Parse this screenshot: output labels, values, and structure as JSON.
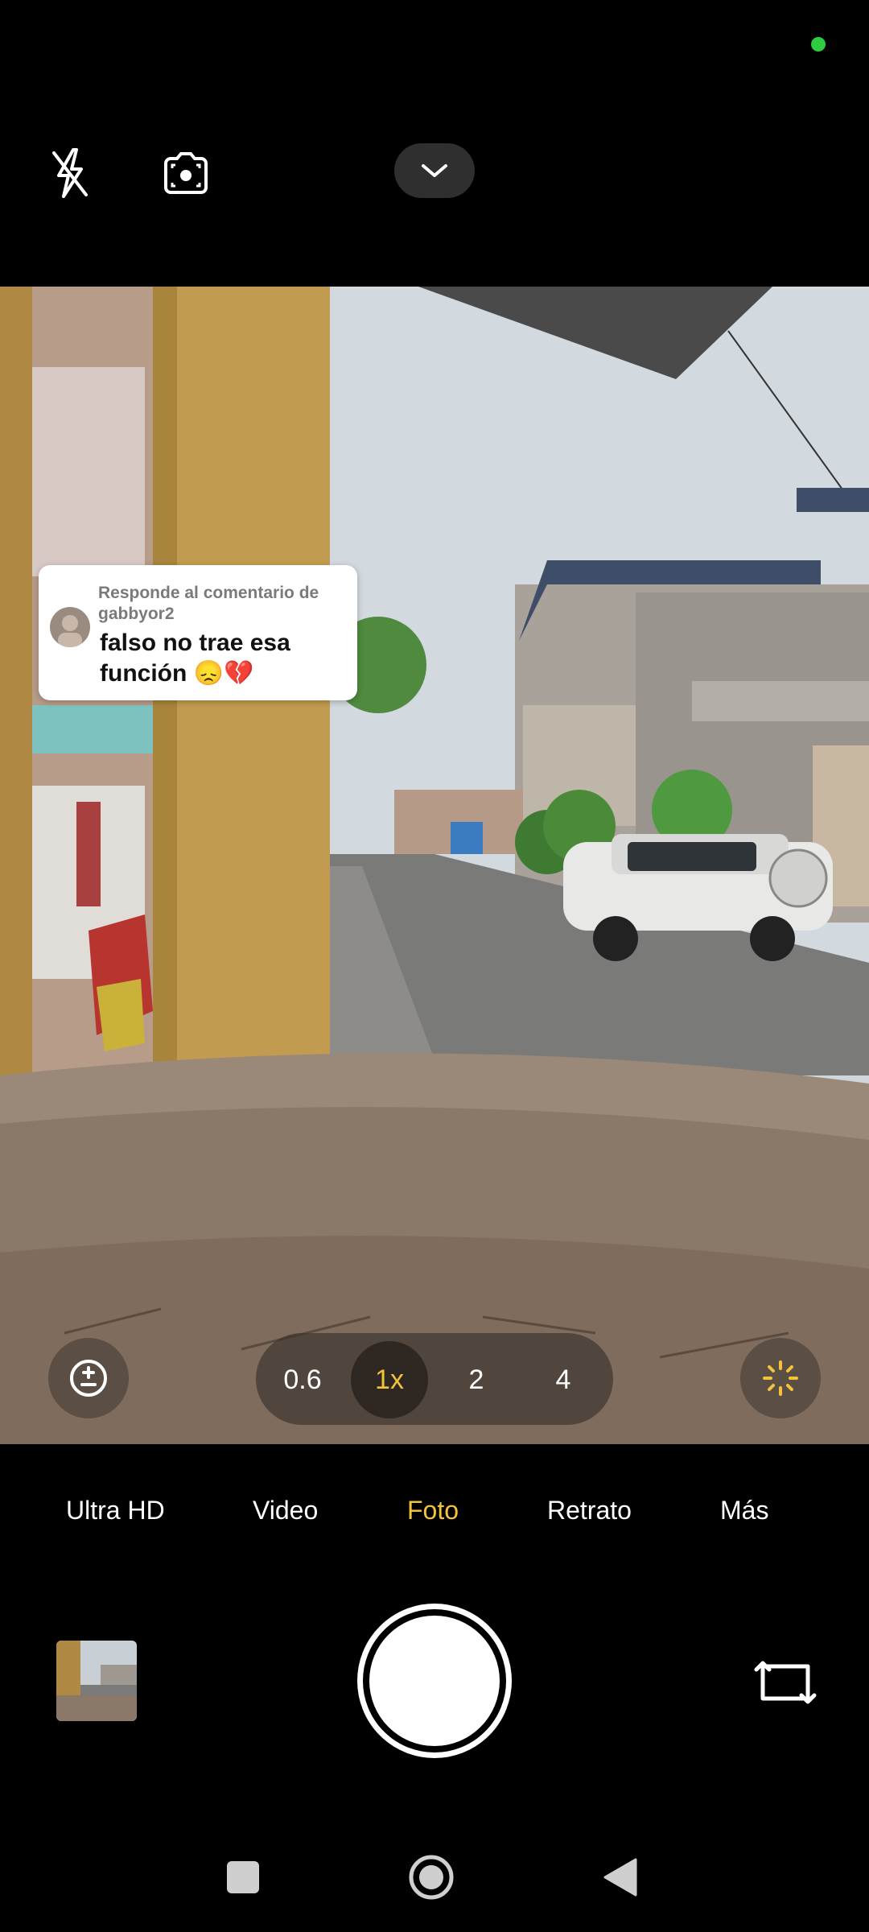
{
  "status": {
    "indicator_color": "#2ecc40"
  },
  "top_bar": {
    "flash_icon": "flash-off-icon",
    "lens_icon": "camera-lens-icon",
    "collapse_icon": "chevron-down-icon"
  },
  "comment": {
    "header": "Responde al comentario de gabbyor2",
    "text": "falso no trae esa función 😞💔"
  },
  "viewfinder_controls": {
    "exposure_icon": "exposure-plus-minus-icon",
    "effects_icon": "sparkle-icon",
    "zoom_options": [
      "0.6",
      "1x",
      "2",
      "4"
    ],
    "zoom_selected": "1x"
  },
  "modes": [
    "Ultra HD",
    "Video",
    "Foto",
    "Retrato",
    "Más"
  ],
  "mode_selected": "Foto",
  "bottom": {
    "gallery_icon": "gallery-thumbnail",
    "shutter_icon": "shutter-button",
    "switch_icon": "switch-camera-icon"
  },
  "nav": {
    "recents_icon": "square-icon",
    "home_icon": "circle-icon",
    "back_icon": "triangle-back-icon"
  },
  "colors": {
    "accent": "#f3c33a",
    "background": "#000000"
  }
}
